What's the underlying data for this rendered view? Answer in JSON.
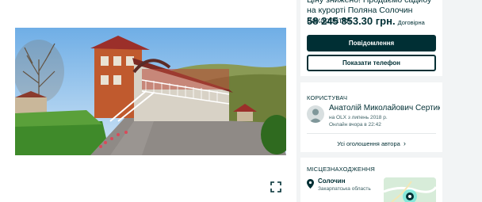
{
  "listing": {
    "title": "Ціну знижено! Продаємо садибу на курорті Поляна Солочин Закарпаття",
    "price": "58 245 853.30 грн.",
    "negotiable": "Договірна"
  },
  "actions": {
    "message": "Повідомлення",
    "show_phone": "Показати телефон"
  },
  "seller": {
    "section": "КОРИСТУВАЧ",
    "name": "Анатолій Миколайович Сертик",
    "since": "на OLX з липень 2018 р.",
    "online": "Онлайн вчора в 22:42",
    "all_ads": "Усі оголошення автора"
  },
  "location": {
    "section": "МІСЦЕЗНАХОДЖЕННЯ",
    "city": "Солочин",
    "region": "Закарпатська область"
  },
  "icons": {
    "expand": "expand-icon",
    "chevron": "chevron-right-icon",
    "pin": "location-pin-icon",
    "map": "map-icon"
  },
  "colors": {
    "primary": "#002f34",
    "background": "#f2f4f5"
  }
}
